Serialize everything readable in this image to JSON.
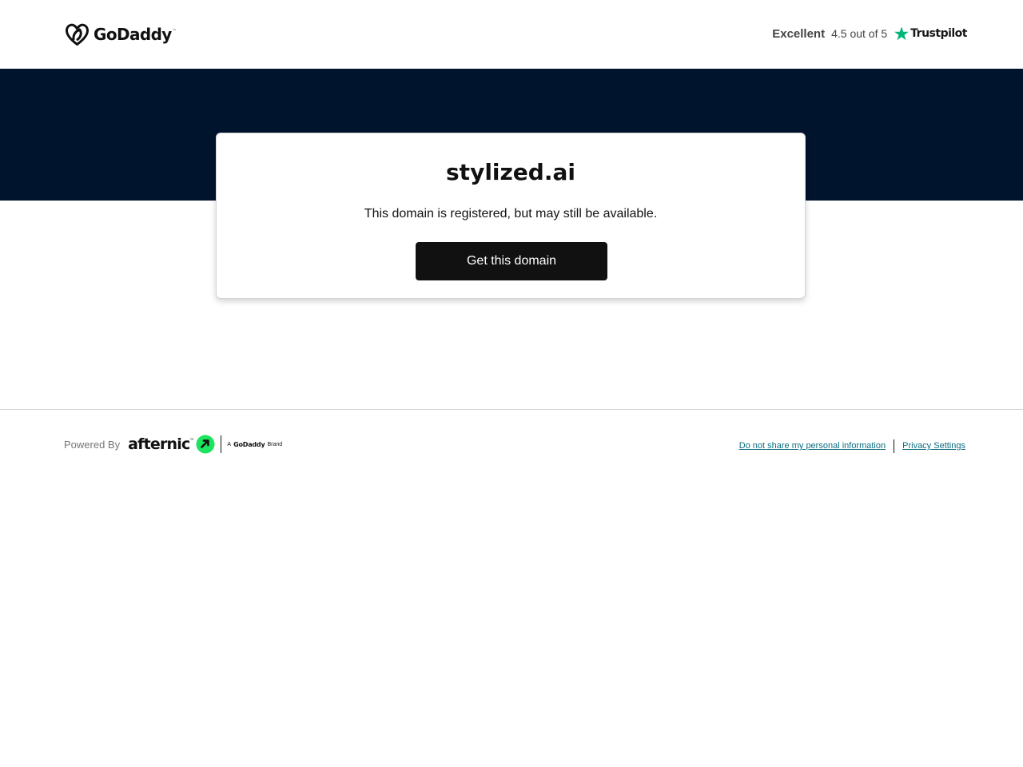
{
  "header": {
    "logo": {
      "icon": "godaddy-heart-icon",
      "text": "GoDaddy",
      "tm": "™"
    },
    "rating": {
      "word": "Excellent",
      "score": "4.5 out of 5",
      "icon": "trustpilot-star-icon",
      "brand": "Trustpilot"
    }
  },
  "hero": {
    "domain": "stylized.ai",
    "status": "This domain is registered, but may still be available.",
    "cta_label": "Get this domain"
  },
  "footer": {
    "powered_by": "Powered By",
    "brand": {
      "name": "afternic",
      "tm": "™",
      "icon": "afternic-arrows-icon",
      "a_label": "A",
      "parent": "GoDaddy",
      "brand_word": "Brand"
    },
    "links": {
      "do_not_share": "Do not share my personal information",
      "privacy": "Privacy Settings"
    }
  },
  "colors": {
    "hero_bg": "#00142d",
    "cta_bg": "#111111",
    "trustpilot_green": "#00b67a",
    "afternic_green": "#1ee35f",
    "link": "#0b6d82"
  }
}
